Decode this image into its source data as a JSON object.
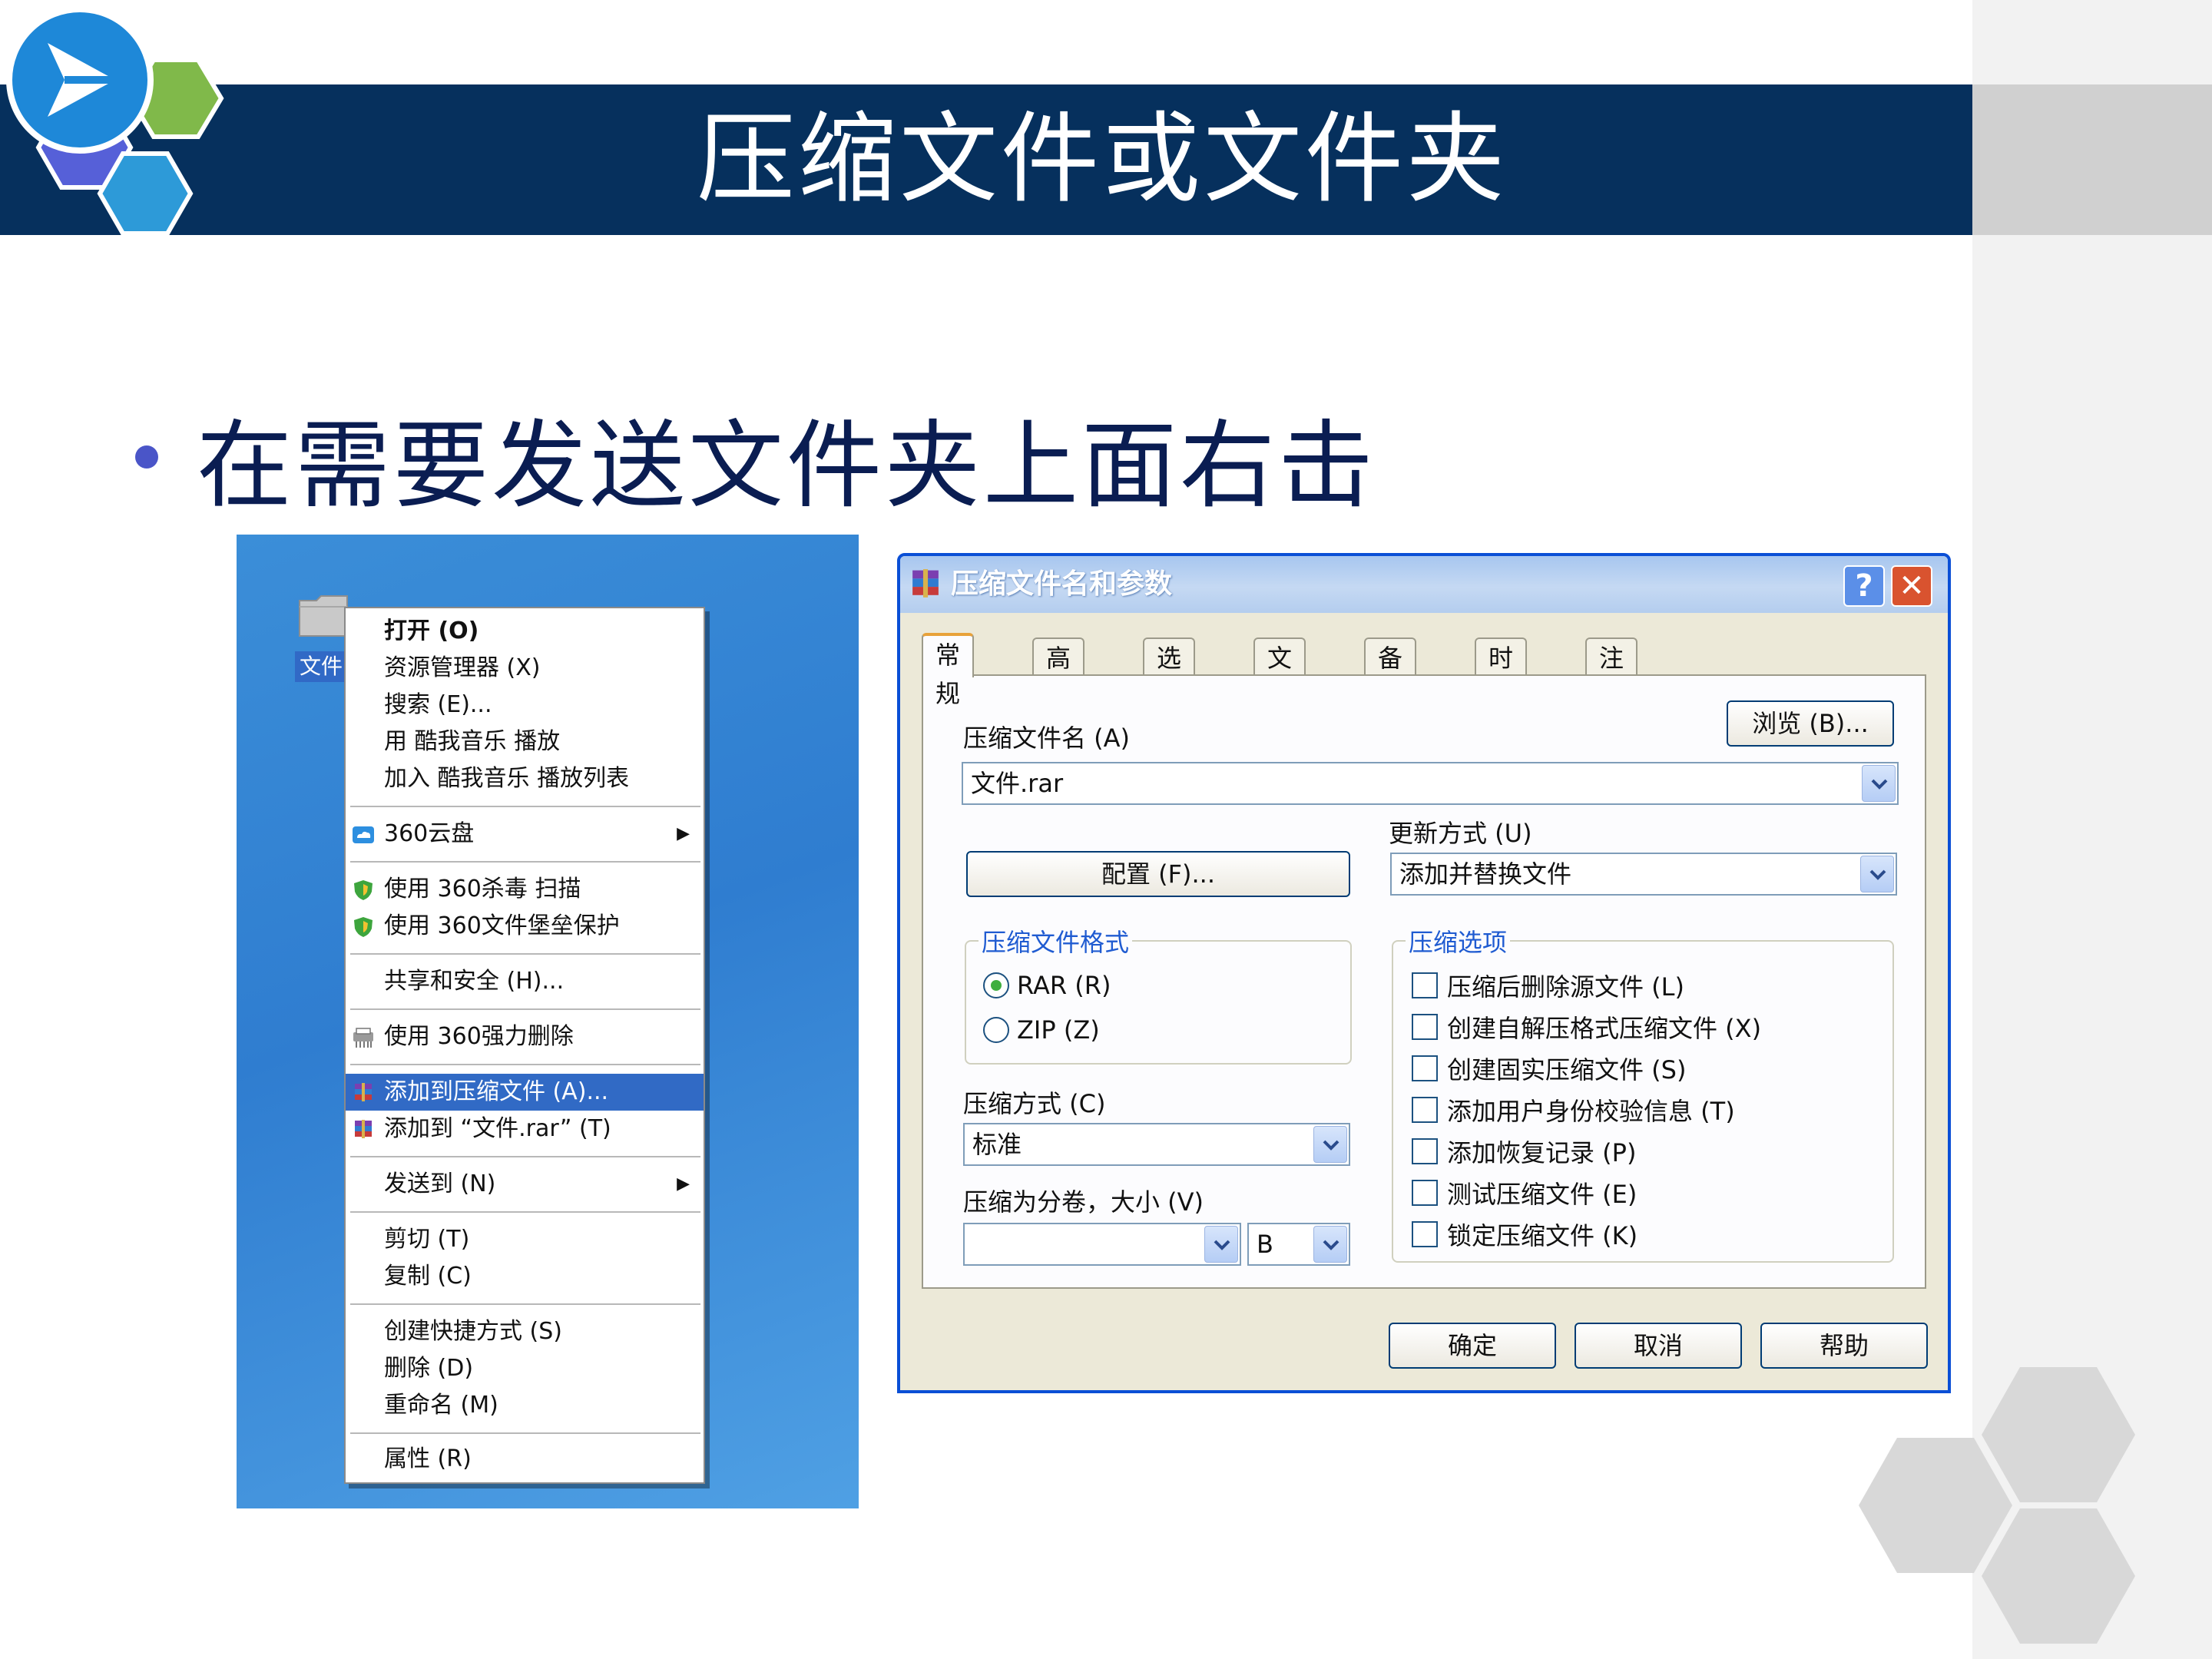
{
  "slide": {
    "title": "压缩文件或文件夹",
    "bullet": "在需要发送文件夹上面右击"
  },
  "colors": {
    "title_bar": "#06305d",
    "bullet_dot": "#4a55c8",
    "menu_highlight": "#316ac5",
    "dialog_border": "#0a4fd6",
    "group_title": "#1f5bd1"
  },
  "desktop": {
    "folder_label": "文件"
  },
  "context_menu": {
    "items": [
      {
        "label": "打开 (O)",
        "icon": "",
        "submenu": false,
        "bold": true
      },
      {
        "label": "资源管理器 (X)",
        "icon": "",
        "submenu": false
      },
      {
        "label": "搜索 (E)...",
        "icon": "",
        "submenu": false
      },
      {
        "label": "用 酷我音乐 播放",
        "icon": "",
        "submenu": false
      },
      {
        "label": "加入 酷我音乐 播放列表",
        "icon": "",
        "submenu": false
      },
      {
        "label": "360云盘",
        "icon": "cloud-icon",
        "submenu": true
      },
      {
        "label": "使用 360杀毒 扫描",
        "icon": "shield-icon",
        "submenu": false
      },
      {
        "label": "使用 360文件堡垒保护",
        "icon": "shield-icon",
        "submenu": false
      },
      {
        "label": "共享和安全 (H)...",
        "icon": "",
        "submenu": false
      },
      {
        "label": "使用 360强力删除",
        "icon": "shredder-icon",
        "submenu": false
      },
      {
        "label": "添加到压缩文件 (A)...",
        "icon": "winrar-icon",
        "submenu": false,
        "selected": true
      },
      {
        "label": "添加到 “文件.rar” (T)",
        "icon": "winrar-icon",
        "submenu": false
      },
      {
        "label": "发送到 (N)",
        "icon": "",
        "submenu": true
      },
      {
        "label": "剪切 (T)",
        "icon": "",
        "submenu": false
      },
      {
        "label": "复制 (C)",
        "icon": "",
        "submenu": false
      },
      {
        "label": "创建快捷方式 (S)",
        "icon": "",
        "submenu": false
      },
      {
        "label": "删除 (D)",
        "icon": "",
        "submenu": false
      },
      {
        "label": "重命名 (M)",
        "icon": "",
        "submenu": false
      },
      {
        "label": "属性 (R)",
        "icon": "",
        "submenu": false
      }
    ]
  },
  "dialog": {
    "title": "压缩文件名和参数",
    "help_btn": "?",
    "close_btn": "✕",
    "tabs": [
      "常规",
      "高级",
      "选项",
      "文件",
      "备份",
      "时间",
      "注释"
    ],
    "active_tab": "常规",
    "archive_name_label": "压缩文件名 (A)",
    "browse_btn": "浏览 (B)...",
    "archive_name_value": "文件.rar",
    "profiles_btn": "配置 (F)...",
    "update_mode_label": "更新方式 (U)",
    "update_mode_value": "添加并替换文件",
    "format_group": "压缩文件格式",
    "format_options": [
      {
        "label": "RAR (R)",
        "checked": true
      },
      {
        "label": "ZIP (Z)",
        "checked": false
      }
    ],
    "method_label": "压缩方式 (C)",
    "method_value": "标准",
    "split_label": "压缩为分卷，大小 (V)",
    "split_value": "",
    "split_unit": "B",
    "options_group": "压缩选项",
    "options": [
      {
        "label": "压缩后删除源文件 (L)",
        "checked": false
      },
      {
        "label": "创建自解压格式压缩文件 (X)",
        "checked": false
      },
      {
        "label": "创建固实压缩文件 (S)",
        "checked": false
      },
      {
        "label": "添加用户身份校验信息 (T)",
        "checked": false
      },
      {
        "label": "添加恢复记录 (P)",
        "checked": false
      },
      {
        "label": "测试压缩文件 (E)",
        "checked": false
      },
      {
        "label": "锁定压缩文件 (K)",
        "checked": false
      }
    ],
    "ok_btn": "确定",
    "cancel_btn": "取消",
    "help_btn_bottom": "帮助"
  }
}
